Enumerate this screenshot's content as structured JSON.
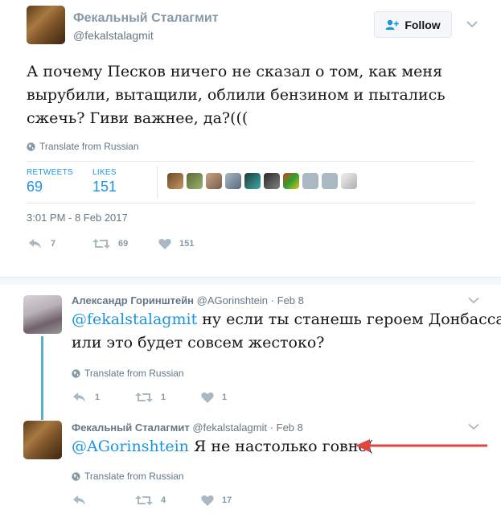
{
  "main_tweet": {
    "author_name": "Фекальный Сталагмит",
    "author_handle": "@fekalstalagmit",
    "follow_label": "Follow",
    "text_lines": [
      "А почему Песков ничего не сказал о том, как меня",
      "вырубили, вытащили, облили бензином и пытались",
      "сжечь? Гиви важнее, да?((("
    ],
    "translate_label": "Translate from Russian",
    "retweets_label": "RETWEETS",
    "retweets_count": "69",
    "likes_label": "LIKES",
    "likes_count": "151",
    "timestamp": "3:01 PM - 8 Feb 2017",
    "reply_count": "7",
    "retweet_count": "69",
    "like_count": "151"
  },
  "replies": [
    {
      "author_name": "Александр Горинштейн",
      "author_handle": "@AGorinshtein",
      "date": "Feb 8",
      "mention": "@fekalstalagmit",
      "text_line1": " ну если ты станешь героем Донбасса.",
      "text_line2": "или это будет совсем жестоко?",
      "translate_label": "Translate from Russian",
      "reply_count": "1",
      "retweet_count": "1",
      "like_count": "1"
    },
    {
      "author_name": "Фекальный Сталагмит",
      "author_handle": "@fekalstalagmit",
      "date": "Feb 8",
      "mention": "@AGorinshtein",
      "text_line1": " Я не настолько говно(",
      "translate_label": "Translate from Russian",
      "reply_count": "",
      "retweet_count": "4",
      "like_count": "17"
    }
  ],
  "colors": {
    "link": "#1b95e0",
    "muted": "#657786",
    "arrow": "#e0453f",
    "thread_line": "#5aaecf"
  },
  "icons": [
    "follow-person-icon",
    "chevron-down-icon",
    "globe-icon",
    "reply-icon",
    "retweet-icon",
    "heart-icon",
    "red-arrow-annotation"
  ]
}
